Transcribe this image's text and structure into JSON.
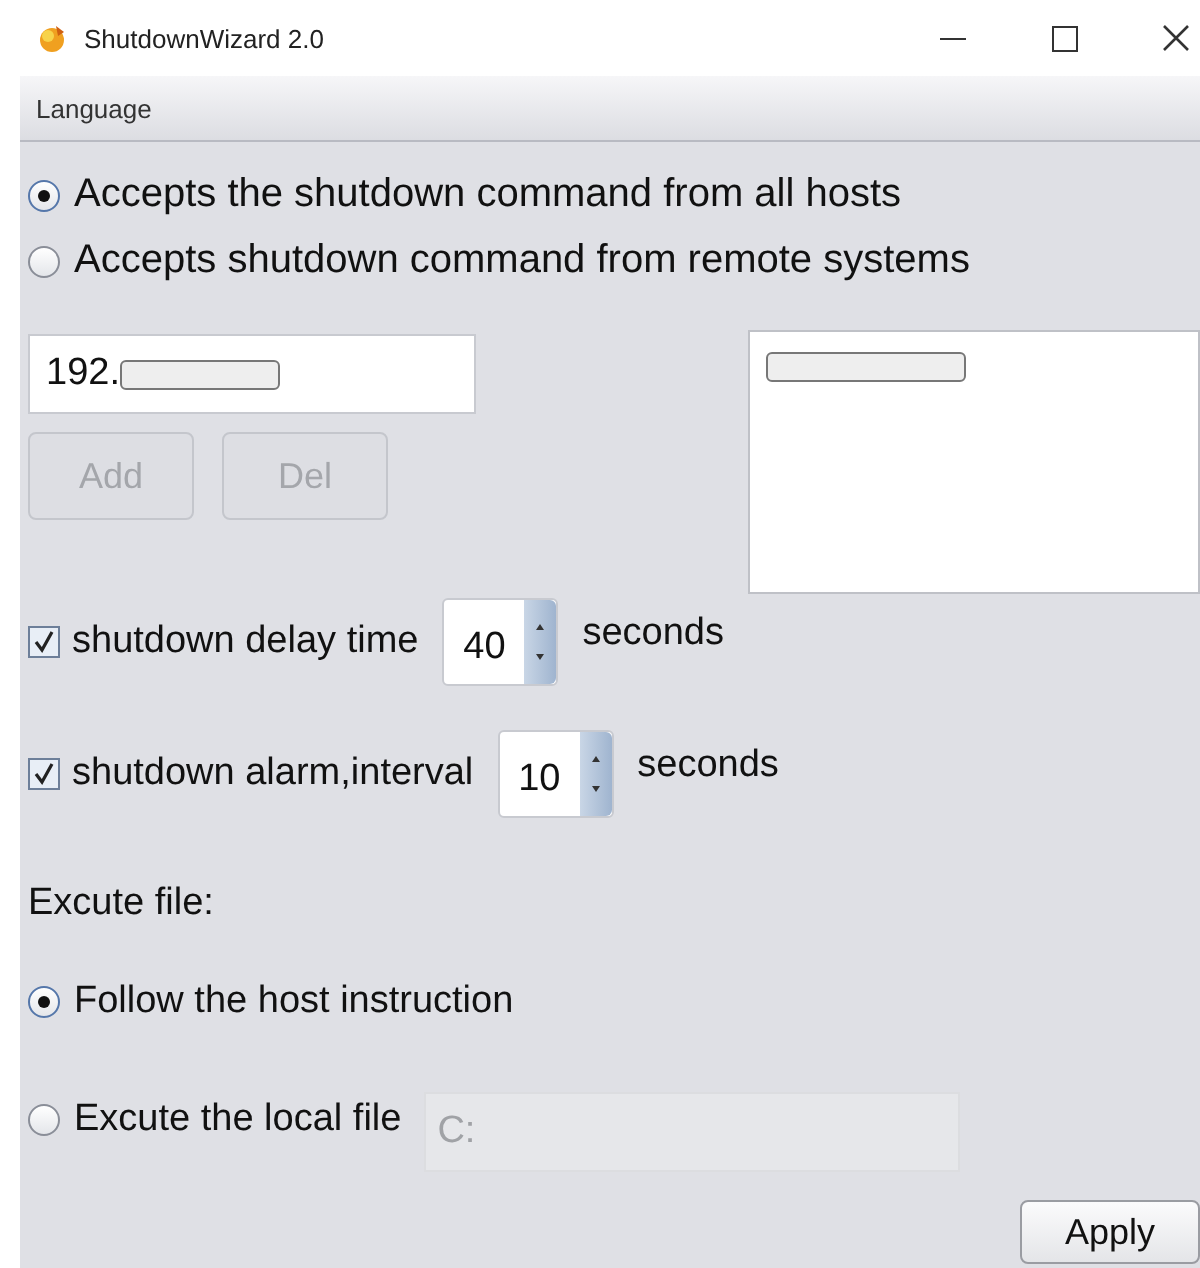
{
  "window": {
    "title": "ShutdownWizard 2.0"
  },
  "menu": [
    "Language"
  ],
  "accept_mode": [
    {
      "label": "Accepts the shutdown command from all hosts",
      "selected": true
    },
    {
      "label": "Accepts shutdown command from remote systems",
      "selected": false
    }
  ],
  "host_field": {
    "value": "192.",
    "redacted": true
  },
  "host_buttons": [
    {
      "label": "Add",
      "disabled": true
    },
    {
      "label": "Del",
      "disabled": true
    }
  ],
  "host_list": [
    {
      "redacted": true
    }
  ],
  "options": [
    {
      "label": "shutdown delay time",
      "checked": true,
      "value": "40",
      "unit": "seconds"
    },
    {
      "label": "shutdown alarm,interval",
      "checked": true,
      "value": "10",
      "unit": "seconds"
    }
  ],
  "execute": {
    "heading": "Excute file:",
    "choices": [
      {
        "label": "Follow the host instruction",
        "selected": true
      },
      {
        "label": "Excute the local file",
        "selected": false
      }
    ],
    "file_field": {
      "value": "C:",
      "disabled": true
    }
  },
  "apply_button": "Apply"
}
